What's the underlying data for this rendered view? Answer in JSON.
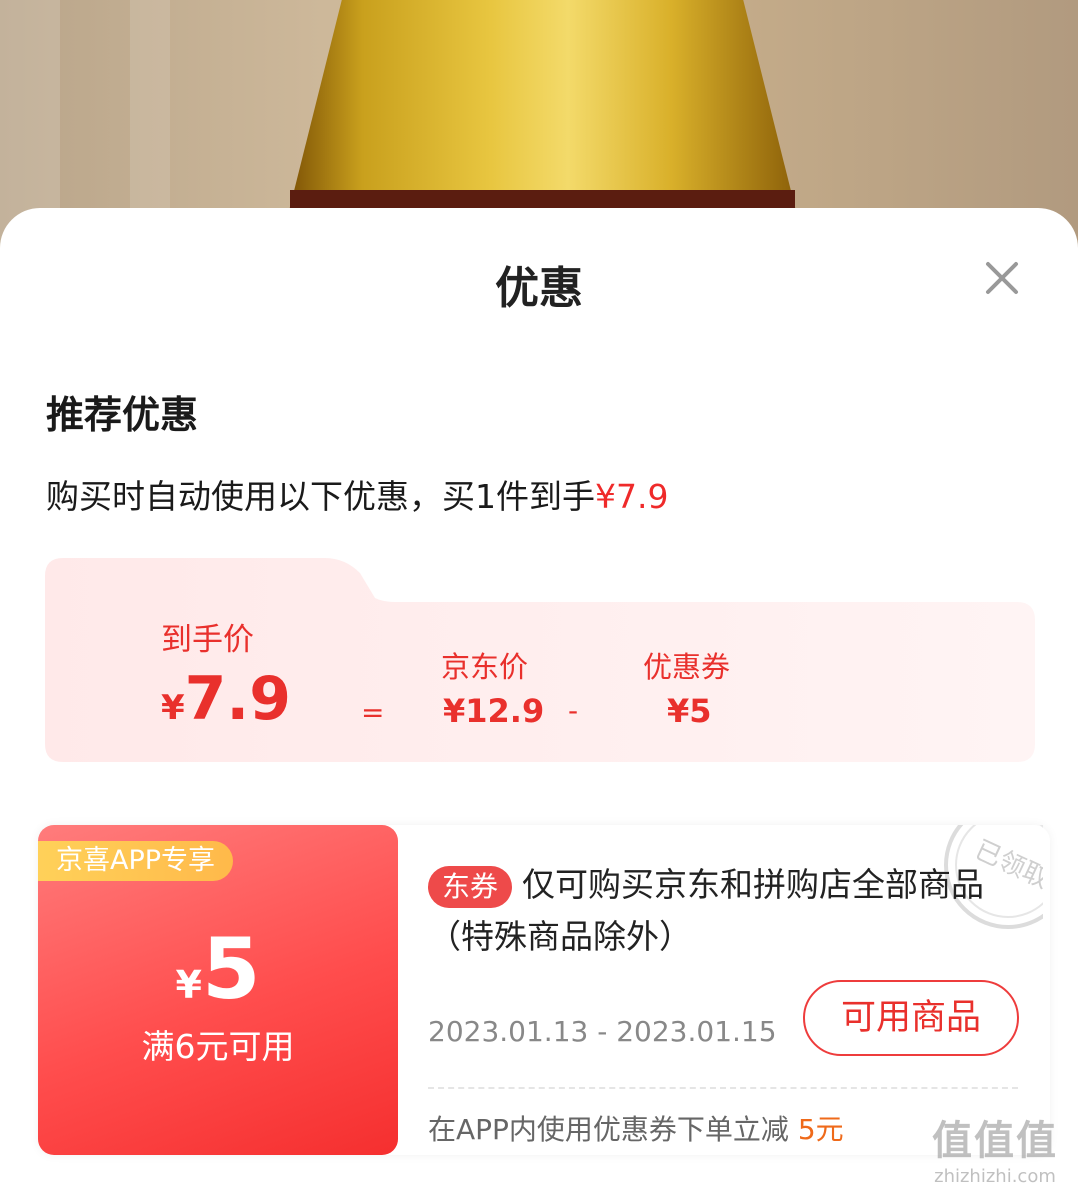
{
  "sheet": {
    "title": "优惠",
    "close_icon": "close-icon"
  },
  "recommend": {
    "title": "推荐优惠",
    "desc_prefix": "购买时自动使用以下优惠，买1件到手",
    "desc_price": "¥7.9"
  },
  "breakdown": {
    "final_label": "到手价",
    "final_yen": "¥",
    "final_value": "7.9",
    "equals": "=",
    "jd_label": "京东价",
    "jd_value": "¥12.9",
    "minus": "-",
    "coupon_label": "优惠券",
    "coupon_value": "¥5"
  },
  "coupon": {
    "exclusive_tag": "京喜APP专享",
    "yen": "¥",
    "amount": "5",
    "condition": "满6元可用",
    "type_tag": "东券",
    "description": "仅可购买京东和拼购店全部商品（特殊商品除外）",
    "date_range": "2023.01.13 - 2023.01.15",
    "button_label": "可用商品",
    "note_prefix": "在APP内使用优惠券下单立减",
    "note_amount": "5元",
    "stamp_text": "已领取"
  },
  "watermark": {
    "logo": "值值值",
    "url": "zhizhizhi.com"
  },
  "colors": {
    "accent_red": "#e9302c",
    "coupon_gradient_start": "#ff7c7c",
    "coupon_gradient_end": "#f52f2f",
    "tag_yellow": "#ffd25a",
    "breakdown_bg": "#fff0f0"
  }
}
